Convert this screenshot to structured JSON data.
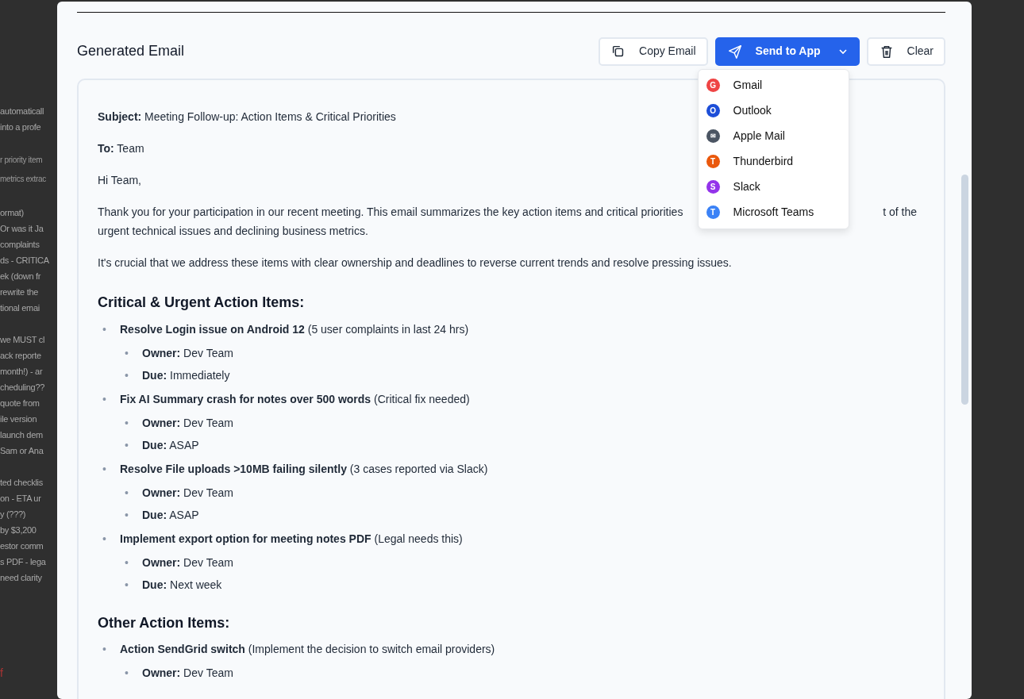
{
  "background": {
    "groups": [
      {
        "lines": [
          "automaticall",
          "into a profe"
        ]
      },
      {
        "small": true,
        "lines": [
          "r priority item",
          "metrics extrac"
        ]
      },
      {
        "lines": [
          "ormat)",
          "Or was it Ja",
          "complaints",
          "ds - CRITICA",
          "ek (down fr",
          "rewrite the",
          "tional emai"
        ]
      },
      {
        "lines": [
          "we MUST cl",
          "ack reporte",
          "month!) - ar",
          "cheduling??",
          "quote from",
          "ile version",
          "launch dem",
          "Sam or Ana"
        ]
      },
      {
        "lines": [
          "ted checklis",
          "on - ETA ur",
          "y (???)",
          "by $3,200",
          "estor comm",
          "s PDF - lega",
          "need clarity"
        ]
      }
    ],
    "footer_mark": "f"
  },
  "modal": {
    "title": "Generated Email",
    "buttons": [
      {
        "kind": "copy",
        "label": "Copy Email"
      },
      {
        "kind": "send",
        "label": "Send to App",
        "expanded": true
      },
      {
        "kind": "clear",
        "label": "Clear"
      }
    ],
    "menu": [
      {
        "letter": "G",
        "label": "Gmail",
        "color": "#ef4444"
      },
      {
        "letter": "O",
        "label": "Outlook",
        "color": "#1d4ed8"
      },
      {
        "letter": "✉",
        "label": "Apple Mail",
        "color": "#4b5563"
      },
      {
        "letter": "T",
        "label": "Thunderbird",
        "color": "#ea580c"
      },
      {
        "letter": "S",
        "label": "Slack",
        "color": "#9333ea"
      },
      {
        "letter": "T",
        "label": "Microsoft Teams",
        "color": "#3b82f6"
      }
    ],
    "email": {
      "blocks": [
        {
          "kind": "para",
          "text": "**Subject:** Meeting Follow-up: Action Items & Critical Priorities"
        },
        {
          "kind": "para",
          "text": "**To:** Team"
        },
        {
          "kind": "para",
          "text": "Hi Team,"
        },
        {
          "kind": "lines",
          "lines": [
            {
              "left": "Thank you for your participation in our recent meeting. This email summarizes the key action items and critical priorities",
              "right": "t of the"
            },
            {
              "left": "urgent technical issues and declining business metrics."
            }
          ]
        },
        {
          "kind": "para",
          "text": "It's crucial that we address these items with clear ownership and deadlines to reverse current trends and resolve pressing issues."
        },
        {
          "kind": "heading",
          "text": "Critical & Urgent Action Items:"
        },
        {
          "kind": "list",
          "bullet": "•",
          "items": [
            {
              "text": "**Resolve Login issue on Android 12** (5 user complaints in last 24 hrs)",
              "sub": [
                "**Owner:** Dev Team",
                "**Due:** Immediately"
              ]
            },
            {
              "text": "**Fix AI Summary crash for notes over 500 words** (Critical fix needed)",
              "sub": [
                "**Owner:** Dev Team",
                "**Due:** ASAP"
              ]
            },
            {
              "text": "**Resolve File uploads >10MB failing silently** (3 cases reported via Slack)",
              "sub": [
                "**Owner:** Dev Team",
                "**Due:** ASAP"
              ]
            },
            {
              "text": "**Implement export option for meeting notes PDF** (Legal needs this)",
              "sub": [
                "**Owner:** Dev Team",
                "**Due:** Next week"
              ]
            }
          ]
        },
        {
          "kind": "heading",
          "text": "Other Action Items:"
        },
        {
          "kind": "list",
          "bullet": "•",
          "items": [
            {
              "text": "**Action SendGrid switch** (Implement the decision to switch email providers)",
              "sub": [
                "**Owner:** Dev Team"
              ]
            }
          ]
        }
      ]
    }
  }
}
